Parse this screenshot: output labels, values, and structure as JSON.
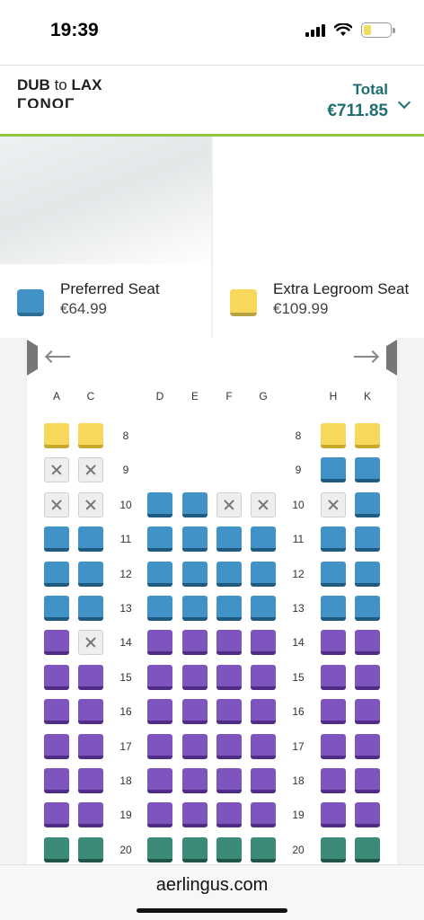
{
  "status": {
    "time": "19:39",
    "battery_level": 0.3
  },
  "header": {
    "from": "DUB",
    "connector": "to",
    "to": "LAX",
    "subtitle": "ΓΟΝΟΓ",
    "total_label": "Total",
    "total_value": "€711.85"
  },
  "legend": [
    {
      "name": "Preferred Seat",
      "price": "€64.99",
      "color": "#4192c6"
    },
    {
      "name": "Extra Legroom Seat",
      "price": "€109.99",
      "color": "#f7d85a"
    }
  ],
  "seatmap": {
    "columns": [
      "A",
      "C",
      "D",
      "E",
      "F",
      "G",
      "H",
      "K"
    ],
    "rows": [
      {
        "num": "8",
        "seats": [
          "legroom",
          "legroom",
          null,
          null,
          null,
          null,
          "legroom",
          "legroom"
        ]
      },
      {
        "num": "9",
        "seats": [
          "occupied",
          "occupied",
          null,
          null,
          null,
          null,
          "preferred",
          "preferred"
        ]
      },
      {
        "num": "10",
        "seats": [
          "occupied",
          "occupied",
          "preferred",
          "preferred",
          "occupied",
          "occupied",
          "occupied",
          "preferred"
        ]
      },
      {
        "num": "11",
        "seats": [
          "preferred",
          "preferred",
          "preferred",
          "preferred",
          "preferred",
          "preferred",
          "preferred",
          "preferred"
        ]
      },
      {
        "num": "12",
        "seats": [
          "preferred",
          "preferred",
          "preferred",
          "preferred",
          "preferred",
          "preferred",
          "preferred",
          "preferred"
        ]
      },
      {
        "num": "13",
        "seats": [
          "preferred",
          "preferred",
          "preferred",
          "preferred",
          "preferred",
          "preferred",
          "preferred",
          "preferred"
        ]
      },
      {
        "num": "14",
        "seats": [
          "standard",
          "occupied",
          "standard",
          "standard",
          "standard",
          "standard",
          "standard",
          "standard"
        ]
      },
      {
        "num": "15",
        "seats": [
          "standard",
          "standard",
          "standard",
          "standard",
          "standard",
          "standard",
          "standard",
          "standard"
        ]
      },
      {
        "num": "16",
        "seats": [
          "standard",
          "standard",
          "standard",
          "standard",
          "standard",
          "standard",
          "standard",
          "standard"
        ]
      },
      {
        "num": "17",
        "seats": [
          "standard",
          "standard",
          "standard",
          "standard",
          "standard",
          "standard",
          "standard",
          "standard"
        ]
      },
      {
        "num": "18",
        "seats": [
          "standard",
          "standard",
          "standard",
          "standard",
          "standard",
          "standard",
          "standard",
          "standard"
        ]
      },
      {
        "num": "19",
        "seats": [
          "standard",
          "standard",
          "standard",
          "standard",
          "standard",
          "standard",
          "standard",
          "standard"
        ]
      },
      {
        "num": "20",
        "seats": [
          "green",
          "green",
          "green",
          "green",
          "green",
          "green",
          "green",
          "green"
        ]
      }
    ]
  },
  "browser": {
    "url": "aerlingus.com"
  }
}
